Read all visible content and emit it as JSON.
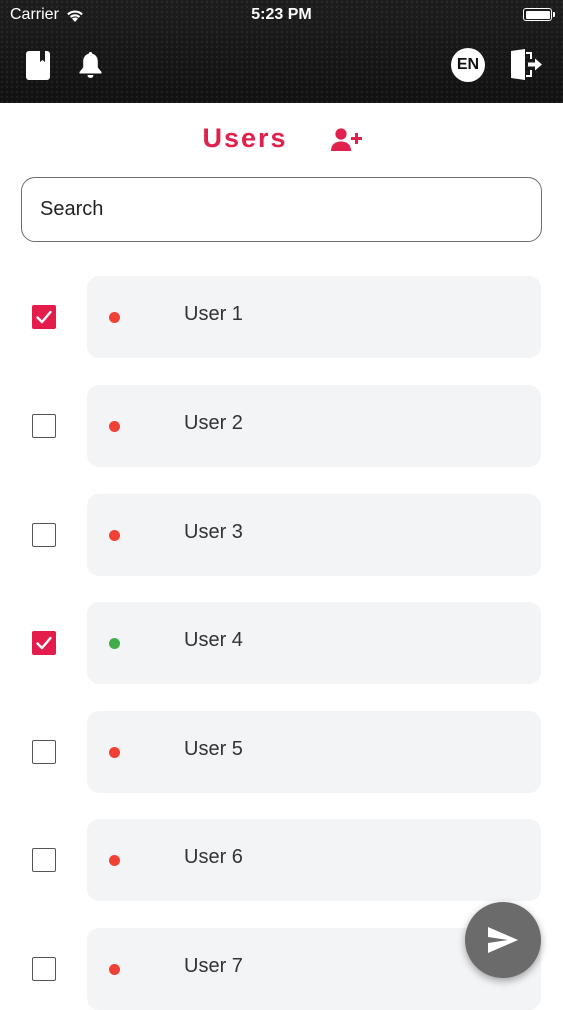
{
  "status_bar": {
    "carrier": "Carrier",
    "time": "5:23 PM"
  },
  "header": {
    "language": "EN"
  },
  "page": {
    "title": "Users"
  },
  "search": {
    "placeholder": "Search",
    "value": ""
  },
  "colors": {
    "accent": "#e31c4c",
    "online": "#3fae49",
    "offline": "#ef4136"
  },
  "users": [
    {
      "name": "User 1",
      "checked": true,
      "status": "offline"
    },
    {
      "name": "User 2",
      "checked": false,
      "status": "offline"
    },
    {
      "name": "User 3",
      "checked": false,
      "status": "offline"
    },
    {
      "name": "User 4",
      "checked": true,
      "status": "online"
    },
    {
      "name": "User 5",
      "checked": false,
      "status": "offline"
    },
    {
      "name": "User 6",
      "checked": false,
      "status": "offline"
    },
    {
      "name": "User 7",
      "checked": false,
      "status": "offline"
    }
  ],
  "icons": {
    "book": "book-icon",
    "bell": "bell-icon",
    "logout": "logout-icon",
    "add_user": "add-user-icon",
    "send": "send-icon",
    "wifi": "wifi-icon",
    "battery": "battery-icon"
  }
}
